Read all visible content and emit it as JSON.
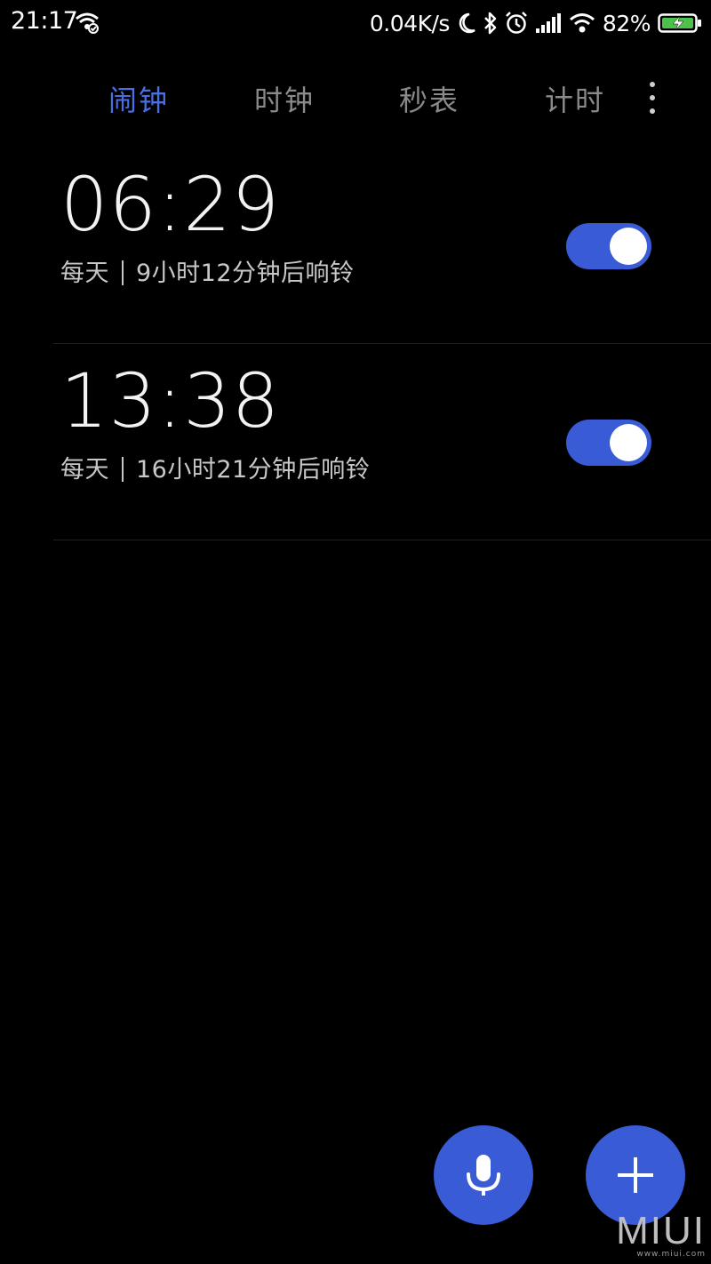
{
  "status_bar": {
    "time": "21:17",
    "network_speed": "0.04K/s",
    "battery_percent": "82%",
    "icons": [
      "wifi-hotspot-icon",
      "moon-icon",
      "bluetooth-icon",
      "alarm-clock-icon",
      "signal-icon",
      "wifi-icon",
      "battery-charging-icon"
    ]
  },
  "tabs": [
    {
      "label": "闹钟",
      "active": true
    },
    {
      "label": "时钟",
      "active": false
    },
    {
      "label": "秒表",
      "active": false
    },
    {
      "label": "计时",
      "active": false
    }
  ],
  "alarms": [
    {
      "time": "06:29",
      "repeat": "每天",
      "remaining": "9小时12分钟后响铃",
      "enabled": true
    },
    {
      "time": "13:38",
      "repeat": "每天",
      "remaining": "16小时21分钟后响铃",
      "enabled": true
    }
  ],
  "fabs": {
    "voice": "microphone-icon",
    "add": "plus-icon"
  },
  "watermark": {
    "logo": "MIUI",
    "url": "www.miui.com"
  },
  "colors": {
    "accent": "#3a5bd6",
    "active_tab": "#4a6fe0",
    "inactive_tab": "#8a8a8a",
    "background": "#000000"
  }
}
